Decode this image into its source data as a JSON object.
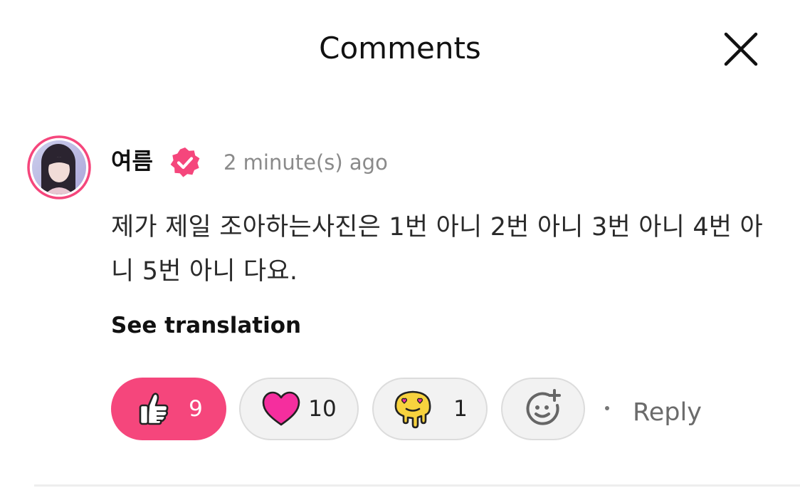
{
  "header": {
    "title": "Comments",
    "close_icon": "close-icon"
  },
  "comment": {
    "username": "여름",
    "verified_icon": "verified-badge-icon",
    "timestamp": "2 minute(s) ago",
    "text": "제가 제일 조아하는사진은 1번 아니 2번 아니 3번 아니 4번 아니 5번 아니 다요.",
    "see_translation_label": "See translation",
    "reactions": [
      {
        "icon": "thumbs-up-icon",
        "count": "9",
        "selected": true
      },
      {
        "icon": "heart-icon",
        "count": "10",
        "selected": false
      },
      {
        "icon": "melting-face-icon",
        "count": "1",
        "selected": false
      },
      {
        "icon": "add-reaction-icon",
        "count": "",
        "selected": false
      }
    ],
    "reply_label": "Reply"
  },
  "colors": {
    "accent": "#f5467c",
    "heart": "#f52e9e",
    "melt": "#f7d23e",
    "muted_text": "#8a8a8a"
  }
}
